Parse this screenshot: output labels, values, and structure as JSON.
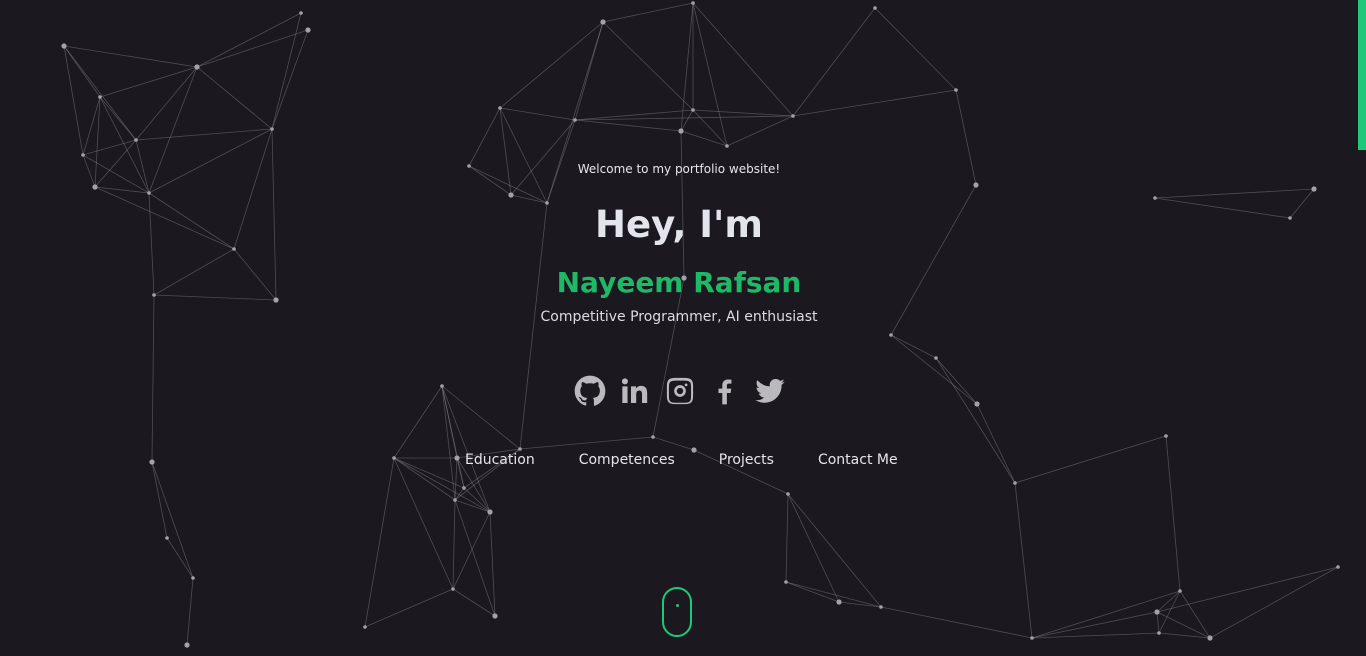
{
  "hero": {
    "welcome": "Welcome to my portfolio website!",
    "greeting": "Hey, I'm",
    "name": "Nayeem Rafsan",
    "tagline": "Competitive Programmer, AI enthusiast"
  },
  "socials": [
    {
      "icon": "github-icon"
    },
    {
      "icon": "linkedin-icon"
    },
    {
      "icon": "instagram-icon"
    },
    {
      "icon": "facebook-icon"
    },
    {
      "icon": "twitter-icon"
    }
  ],
  "nav": {
    "items": [
      {
        "label": "Education"
      },
      {
        "label": "Competences"
      },
      {
        "label": "Projects"
      },
      {
        "label": "Contact Me"
      }
    ]
  },
  "colors": {
    "background": "#1b191f",
    "accent": "#1ec77a",
    "name": "#1fb866",
    "text": "#e4e5ec",
    "icon": "#b9b9be"
  }
}
